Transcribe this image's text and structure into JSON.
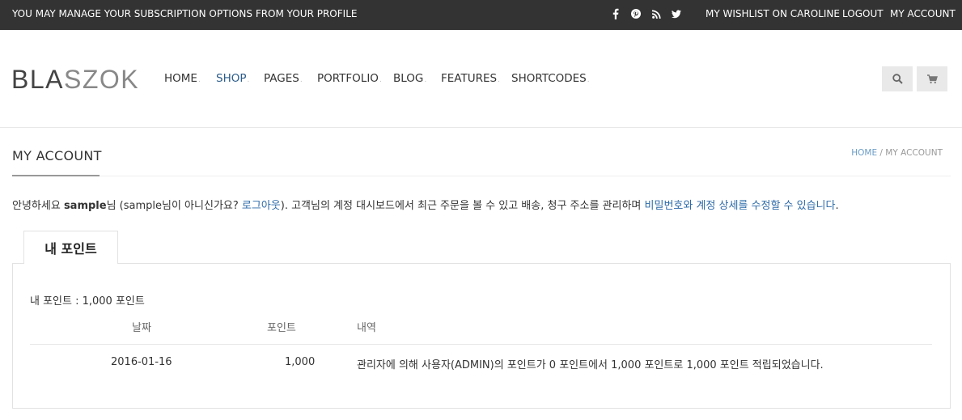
{
  "topbar": {
    "promo": "YOU MAY MANAGE YOUR SUBSCRIPTION OPTIONS FROM YOUR PROFILE",
    "social_icons": [
      "facebook-icon",
      "pinterest-icon",
      "rss-icon",
      "twitter-icon"
    ],
    "social_glyphs": [
      "f",
      "℗",
      "⧉",
      "♥"
    ],
    "wishlist": "MY WISHLIST ON CAROLINE",
    "logout": "LOGOUT",
    "my_account": "MY ACCOUNT"
  },
  "header": {
    "logo_part1": "BLA",
    "logo_part2": "SZOK",
    "nav": [
      {
        "label": "HOME",
        "active": false
      },
      {
        "label": "SHOP",
        "active": true
      },
      {
        "label": "PAGES",
        "active": false
      },
      {
        "label": "PORTFOLIO",
        "active": false
      },
      {
        "label": "BLOG",
        "active": false
      },
      {
        "label": "FEATURES",
        "active": false
      },
      {
        "label": "SHORTCODES",
        "active": false
      }
    ],
    "search_icon": "search-icon",
    "cart_icon": "cart-icon"
  },
  "page": {
    "title": "MY ACCOUNT",
    "breadcrumb_home": "HOME",
    "breadcrumb_sep": " / ",
    "breadcrumb_current": "MY ACCOUNT"
  },
  "greeting": {
    "hello": "안녕하세요 ",
    "username": "sample",
    "after_name": "님 (sample님이 아니신가요? ",
    "logout_link": "로그아웃",
    "middle": "). 고객님의 계정 대시보드에서 최근 주문을 볼 수 있고 배송, 청구 주소를 관리하며 ",
    "edit_link": "비밀번호와 계정 상세를 수정할 수 있습니다",
    "end": "."
  },
  "points": {
    "tab_label": "내 포인트",
    "summary": "내 포인트 : 1,000 포인트",
    "headers": {
      "date": "날짜",
      "points": "포인트",
      "history": "내역"
    },
    "rows": [
      {
        "date": "2016-01-16",
        "points": "1,000",
        "history": "관리자에 의해 사용자(ADMIN)의 포인트가 0 포인트에서 1,000 포인트로 1,000 포인트 적립되었습니다."
      }
    ]
  },
  "colors": {
    "topbar_bg": "#333333",
    "link_blue": "#2b6aa8",
    "nav_active": "#2b5c8a"
  }
}
